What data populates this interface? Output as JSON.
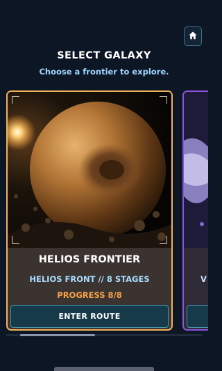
{
  "header": {
    "home_icon": "home-icon",
    "title": "SELECT GALAXY",
    "subtitle": "Choose a frontier to explore."
  },
  "cards": [
    {
      "name": "HELIOS FRONTIER",
      "subtitle": "HELIOS FRONT // 8 STAGES",
      "progress": "PROGRESS 8/8",
      "progress_value": 1.0,
      "button_label": "ENTER ROUTE",
      "accent_color": "#f2b25a"
    },
    {
      "name": "",
      "subtitle": "V",
      "accent_color": "#8a54e0"
    }
  ],
  "carousel": {
    "scroll_position": 0.12,
    "visible_fraction": 0.38
  },
  "colors": {
    "background": "#0d1624",
    "subtitle": "#9fd6ff",
    "progress": "#f5a24a",
    "button": "#163a4a"
  }
}
